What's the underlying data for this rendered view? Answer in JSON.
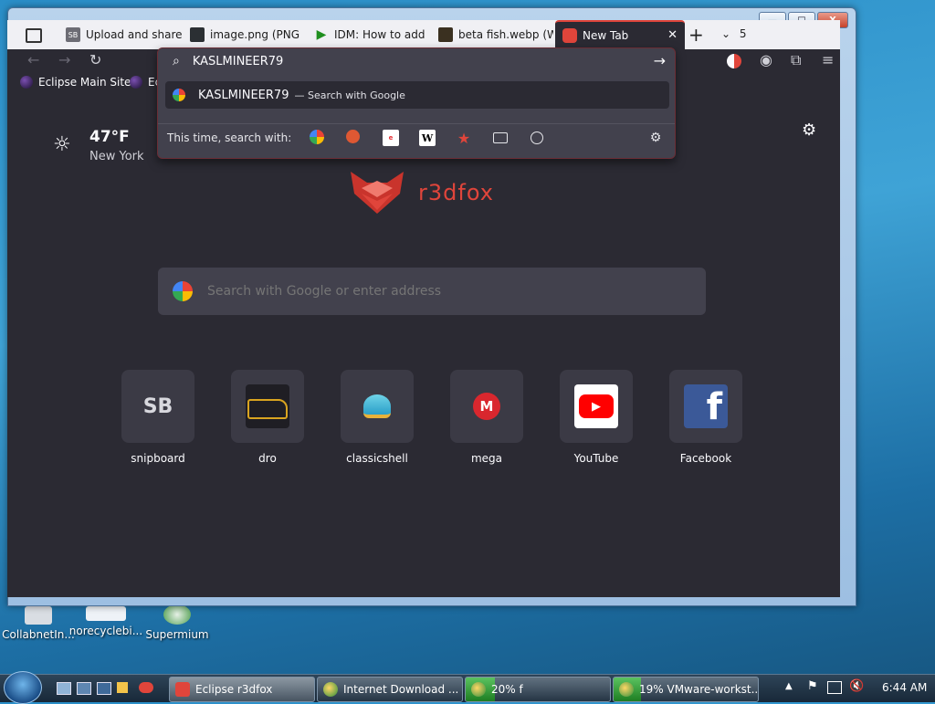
{
  "desktop": {
    "icons": [
      {
        "label": "CollabnetIn..."
      },
      {
        "label": "norecyclebi..."
      },
      {
        "label": "Supermium"
      }
    ]
  },
  "window": {
    "controls": {
      "minimize": "—",
      "maximize": "□",
      "close": "X"
    },
    "tabs": [
      {
        "label": "Upload and share",
        "icon": "SB"
      },
      {
        "label": "image.png (PNG I"
      },
      {
        "label": "IDM: How to add"
      },
      {
        "label": "beta fish.webp (W"
      },
      {
        "label": "New Tab",
        "active": true
      }
    ],
    "tab_count": "5",
    "new_tab_icon": "+",
    "close_tab_icon": "✕"
  },
  "urlbar": {
    "value": "KASLMINEER79",
    "suggestion": {
      "query": "KASLMINEER79",
      "action": "— Search with Google"
    },
    "engines_label": "This time, search with:",
    "engines": [
      "Google",
      "DuckDuckGo",
      "eBay",
      "Wikipedia",
      "Bookmarks",
      "Tabs",
      "History"
    ]
  },
  "bookmarks": [
    {
      "label": "Eclipse Main Site"
    },
    {
      "label": "Ec"
    }
  ],
  "weather": {
    "temp": "47°F",
    "city": "New York"
  },
  "logo": {
    "text": "r3dfox"
  },
  "search": {
    "placeholder": "Search with Google or enter address"
  },
  "tiles": [
    {
      "label": "snipboard",
      "glyph": "SB"
    },
    {
      "label": "dro"
    },
    {
      "label": "classicshell"
    },
    {
      "label": "mega",
      "glyph": "M"
    },
    {
      "label": "YouTube"
    },
    {
      "label": "Facebook",
      "glyph": "f"
    }
  ],
  "taskbar": {
    "items": [
      {
        "label": "Eclipse r3dfox"
      },
      {
        "label": "Internet Download ..."
      },
      {
        "label": "20% f",
        "progress": 0.2
      },
      {
        "label": "19% VMware-workst...",
        "progress": 0.19
      }
    ],
    "clock": "6:44 AM"
  },
  "colors": {
    "accent": "#e0453b",
    "surface": "#2b2a33",
    "panel": "#42414d",
    "text": "#fbfbfe"
  }
}
